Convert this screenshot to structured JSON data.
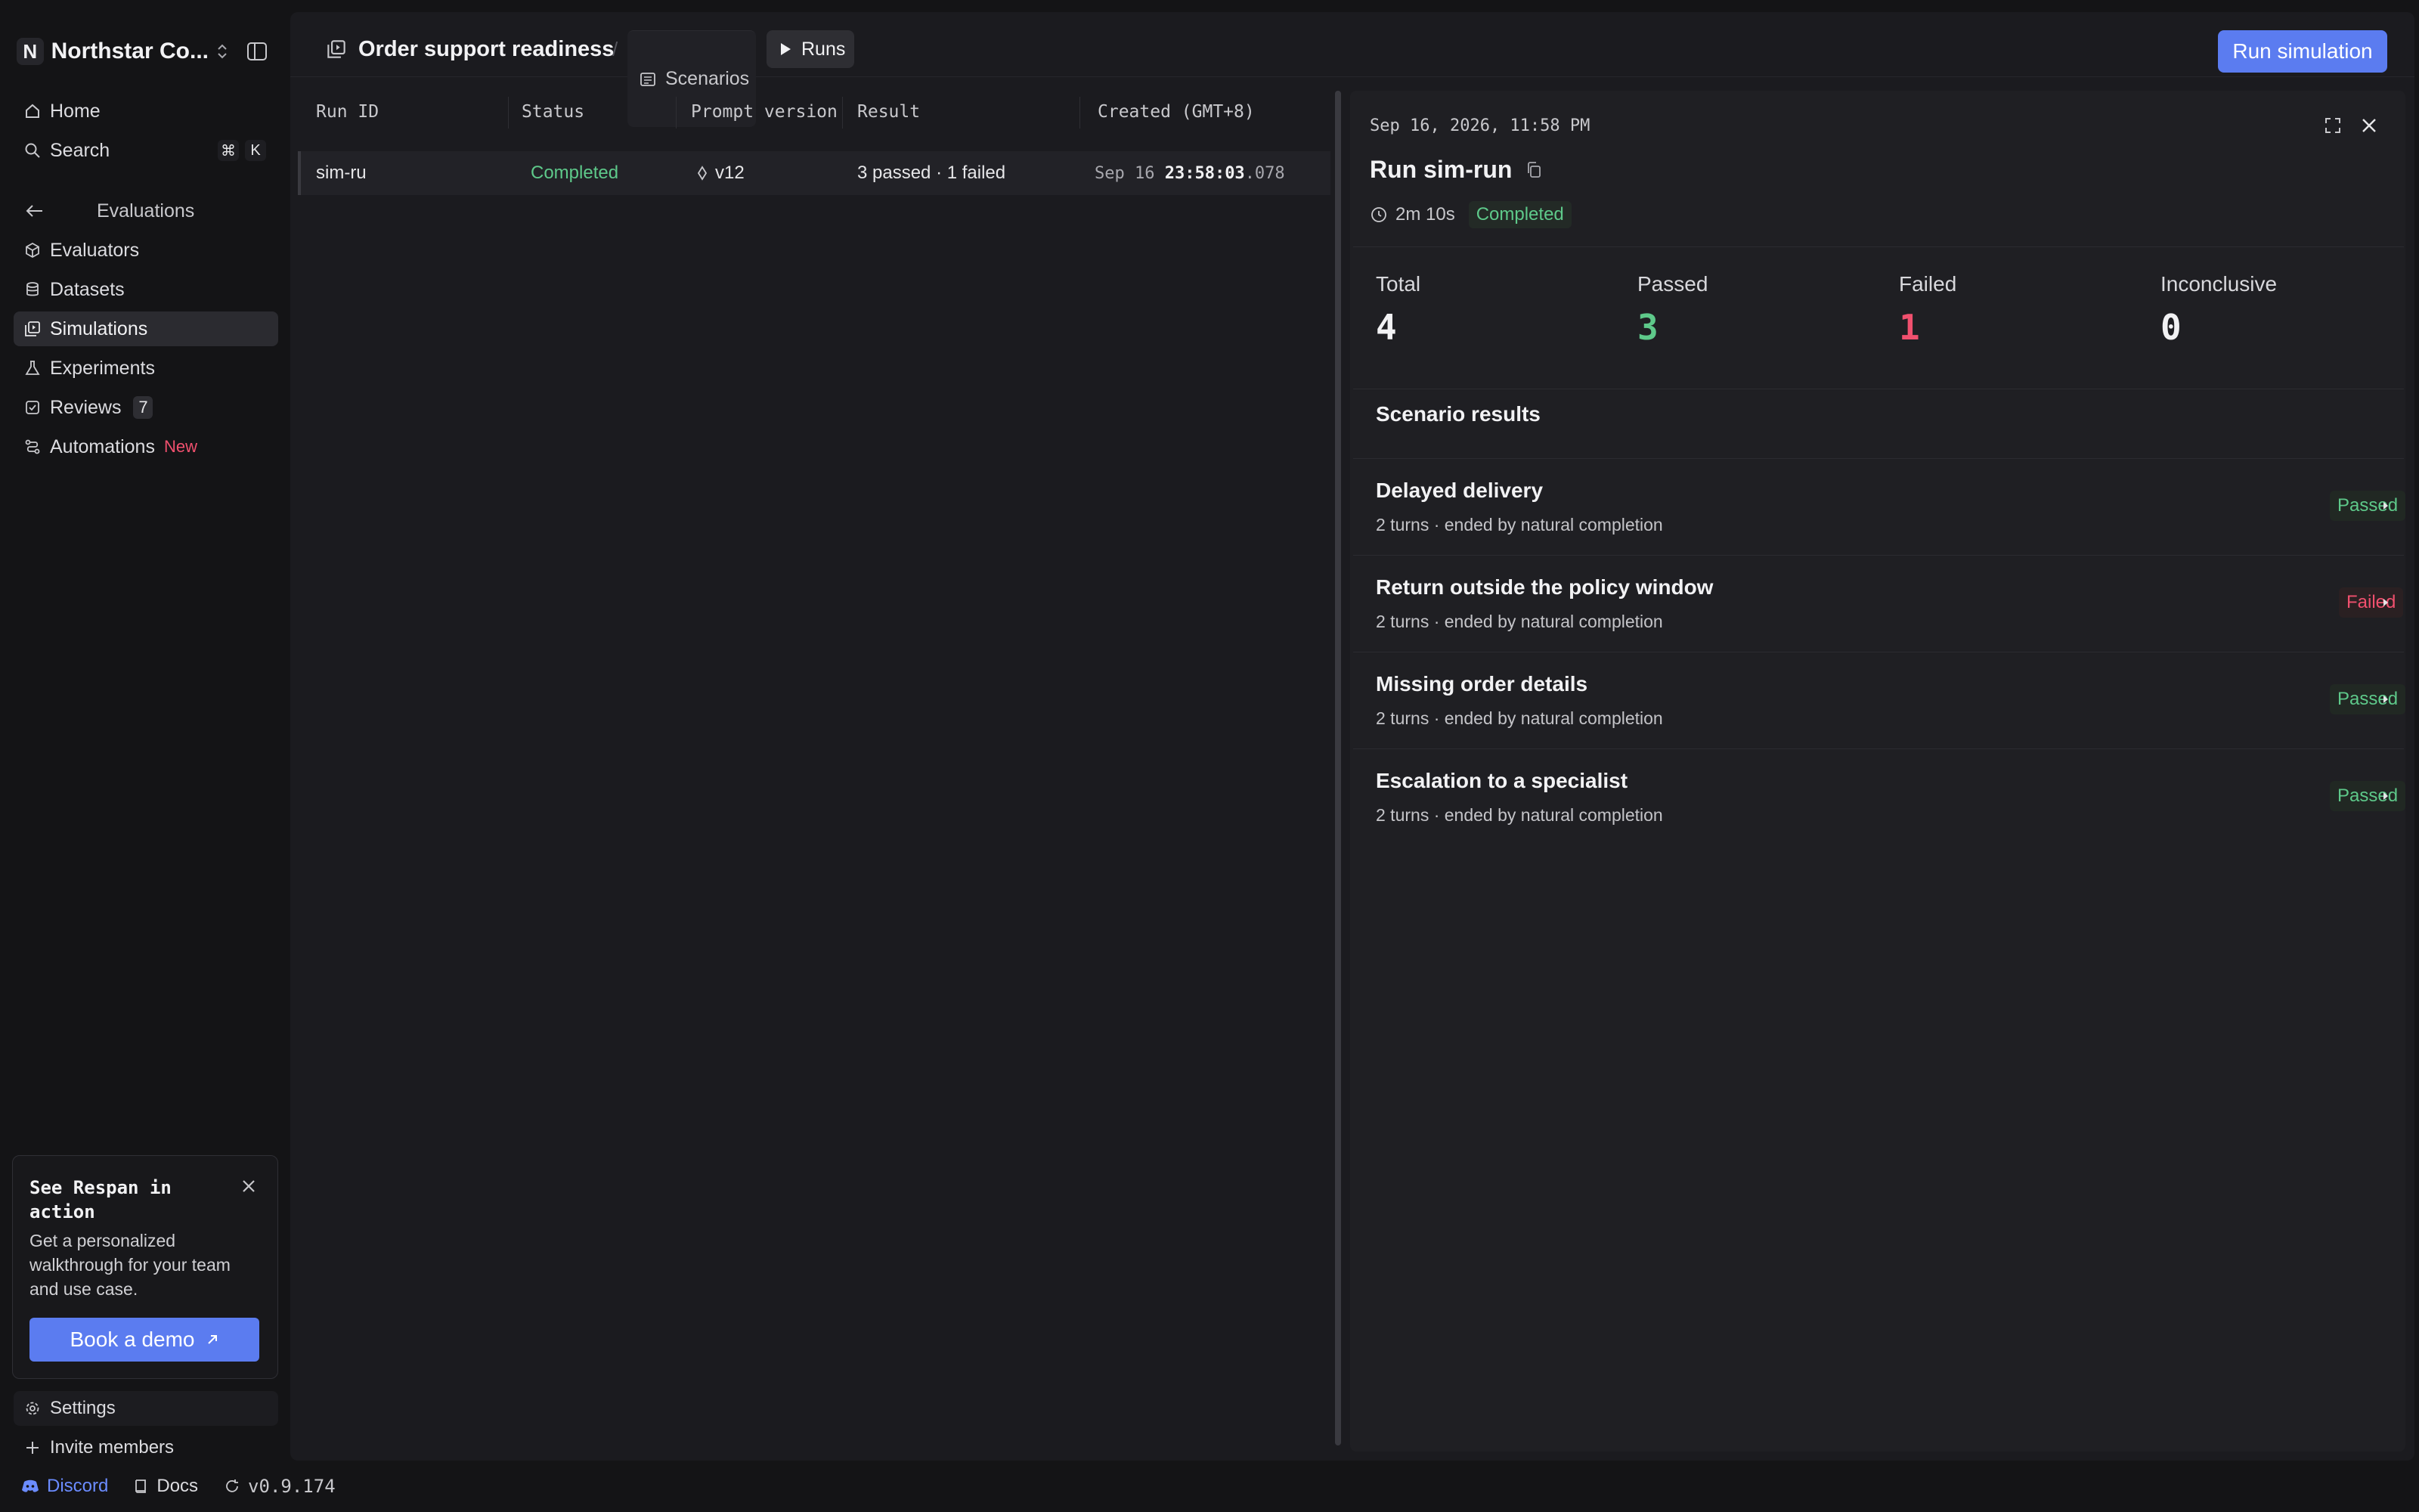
{
  "workspace": {
    "initial": "N",
    "name": "Northstar Co..."
  },
  "nav": {
    "home": "Home",
    "search": "Search",
    "search_keys": [
      "⌘",
      "K"
    ],
    "section": "Evaluations",
    "items": [
      {
        "label": "Evaluators"
      },
      {
        "label": "Datasets"
      },
      {
        "label": "Simulations",
        "active": true
      },
      {
        "label": "Experiments"
      },
      {
        "label": "Reviews",
        "count": "7"
      },
      {
        "label": "Automations",
        "badge": "New"
      }
    ]
  },
  "promo": {
    "title": "See Respan in action",
    "description": "Get a personalized walkthrough for your team and use case.",
    "button": "Book a demo"
  },
  "bottom": {
    "settings": "Settings",
    "invite": "Invite members"
  },
  "footer": {
    "discord": "Discord",
    "docs": "Docs",
    "version": "v0.9.174"
  },
  "header": {
    "title": "Order support readiness",
    "separator": "/",
    "tabs": [
      {
        "label": "Scenarios"
      },
      {
        "label": "Runs",
        "active": true
      }
    ],
    "run_button": "Run simulation"
  },
  "table": {
    "columns": [
      "Run ID",
      "Status",
      "Prompt version",
      "Result",
      "Created (GMT+8)"
    ],
    "rows": [
      {
        "run_id": "sim-ru",
        "status": "Completed",
        "prompt_version": "v12",
        "result": "3 passed · 1 failed",
        "created_date": "Sep 16 ",
        "created_time": "23:58:03",
        "created_ms": ".078"
      }
    ]
  },
  "detail": {
    "date": "Sep 16, 2026, 11:58 PM",
    "title": "Run sim-run",
    "duration": "2m 10s",
    "status": "Completed",
    "stats": [
      {
        "label": "Total",
        "value": "4",
        "color": "#f2f2f4"
      },
      {
        "label": "Passed",
        "value": "3",
        "color": "#5ec98a"
      },
      {
        "label": "Failed",
        "value": "1",
        "color": "#f0506e"
      },
      {
        "label": "Inconclusive",
        "value": "0",
        "color": "#f2f2f4"
      }
    ],
    "section_title": "Scenario results",
    "scenarios": [
      {
        "name": "Delayed delivery",
        "sub": "2 turns · ended by natural completion",
        "result": "Passed"
      },
      {
        "name": "Return outside the policy window",
        "sub": "2 turns · ended by natural completion",
        "result": "Failed"
      },
      {
        "name": "Missing order details",
        "sub": "2 turns · ended by natural completion",
        "result": "Passed"
      },
      {
        "name": "Escalation to a specialist",
        "sub": "2 turns · ended by natural completion",
        "result": "Passed"
      }
    ]
  },
  "colors": {
    "accent": "#5b7cf0",
    "success": "#5ec98a",
    "danger": "#f0506e",
    "background": "#141416",
    "panel": "#1b1b1f"
  }
}
